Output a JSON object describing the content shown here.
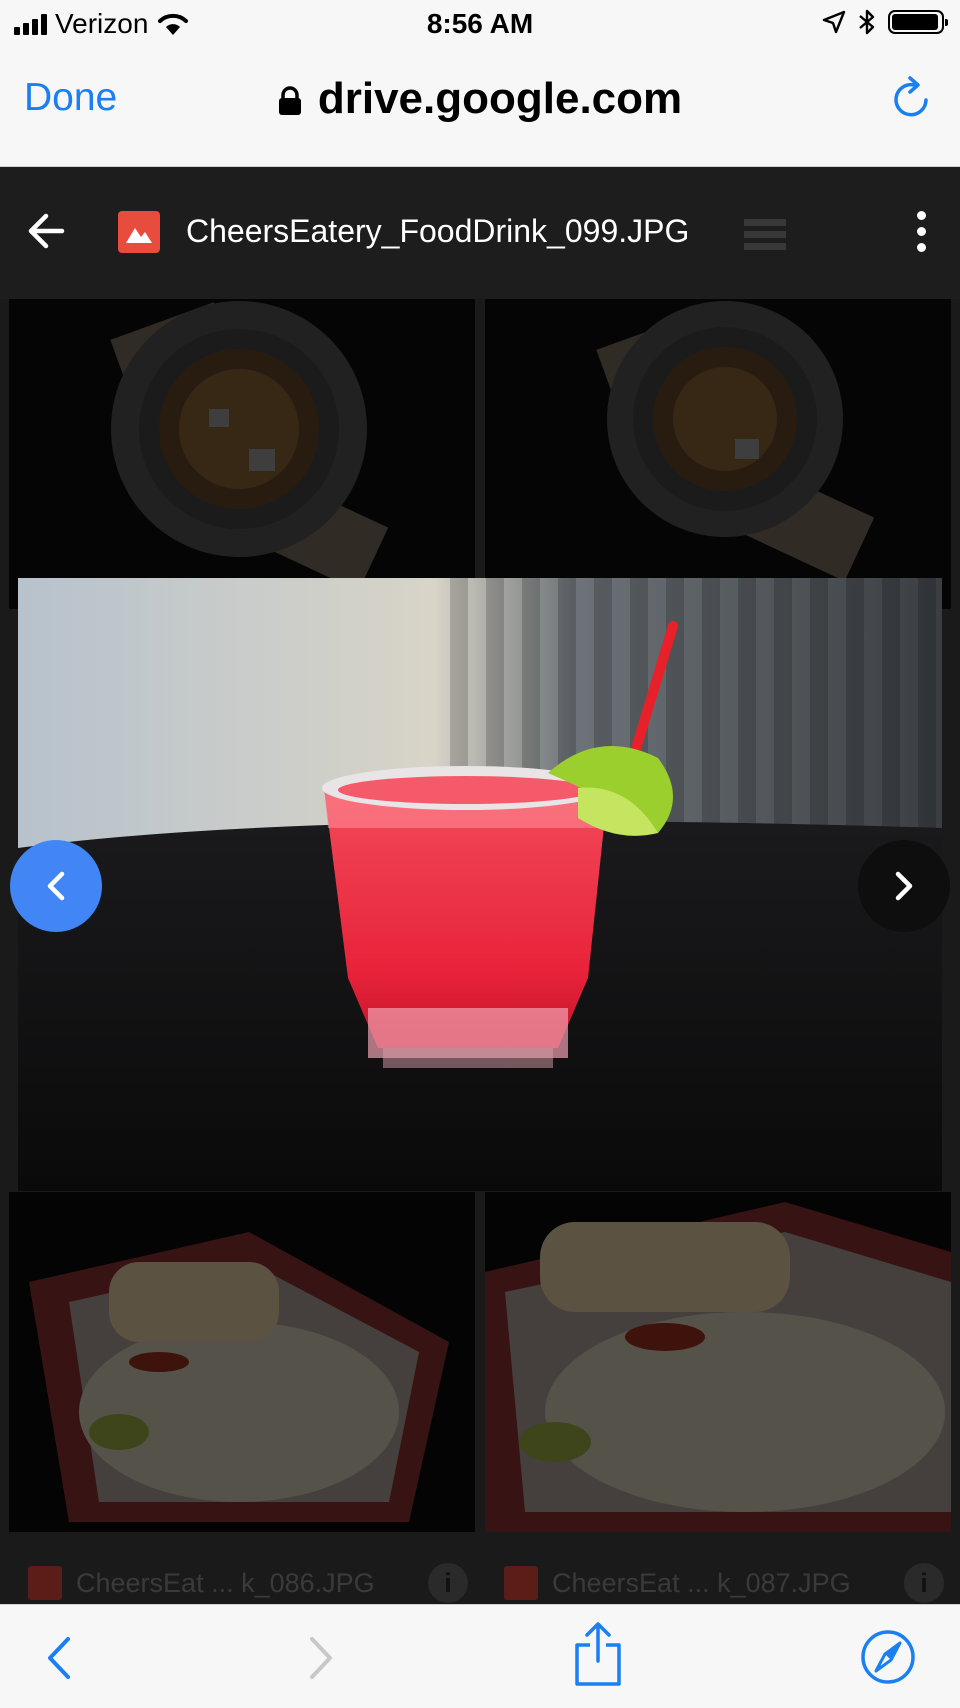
{
  "status_bar": {
    "carrier": "Verizon",
    "time": "8:56 AM"
  },
  "browser": {
    "done_label": "Done",
    "url": "drive.google.com",
    "accent_color": "#1a7ff0"
  },
  "viewer": {
    "file_name": "CheersEatery_FoodDrink_099.JPG",
    "file_badge_color": "#e74c3c",
    "prev_button_color": "#4285f4"
  },
  "grid": {
    "items": [
      {
        "label": ""
      },
      {
        "label": ""
      },
      {
        "label": "CheersEat ... k_086.JPG"
      },
      {
        "label": "CheersEat ... k_087.JPG"
      }
    ]
  },
  "icons": {
    "back": "arrow-left-icon",
    "file": "image-file-icon",
    "more": "more-vert-icon",
    "reload": "reload-icon",
    "prev": "chevron-left-icon",
    "next": "chevron-right-icon",
    "share": "share-icon",
    "compass": "compass-icon"
  }
}
